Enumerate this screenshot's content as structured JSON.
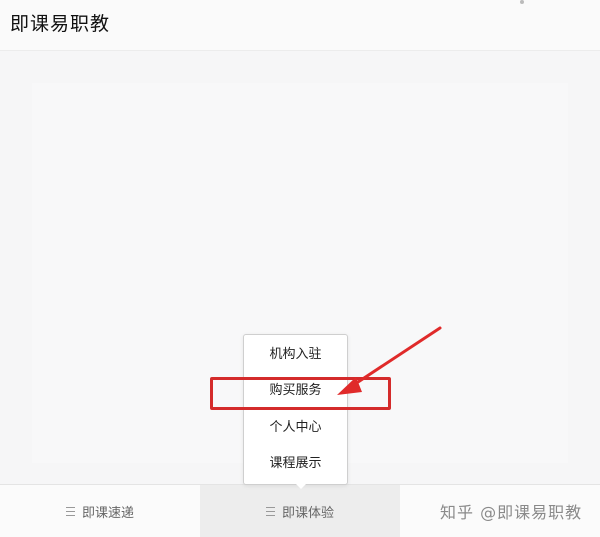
{
  "header": {
    "title": "即课易职教"
  },
  "tabbar": {
    "tabs": [
      {
        "label": "即课速递",
        "active": false
      },
      {
        "label": "即课体验",
        "active": true
      },
      {
        "label": "",
        "active": false
      }
    ]
  },
  "popup_menu": {
    "items": [
      {
        "label": "机构入驻"
      },
      {
        "label": "购买服务",
        "highlighted": true
      },
      {
        "label": "个人中心"
      },
      {
        "label": "课程展示"
      }
    ]
  },
  "annotation": {
    "highlight_color": "#d42b2b",
    "arrow_color": "#e02a2a"
  },
  "watermark": {
    "text": "知乎 @即课易职教"
  }
}
